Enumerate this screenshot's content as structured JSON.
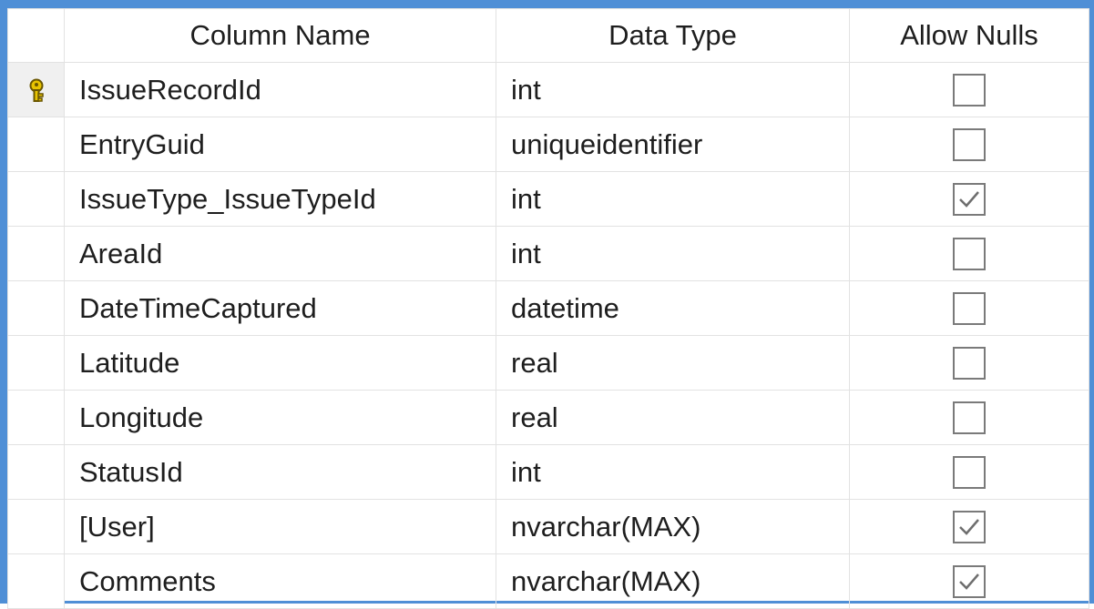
{
  "headers": {
    "column_name": "Column Name",
    "data_type": "Data Type",
    "allow_nulls": "Allow Nulls"
  },
  "rows": [
    {
      "name": "IssueRecordId",
      "type": "int",
      "allow_nulls": false,
      "primary_key": true
    },
    {
      "name": "EntryGuid",
      "type": "uniqueidentifier",
      "allow_nulls": false
    },
    {
      "name": "IssueType_IssueTypeId",
      "type": "int",
      "allow_nulls": true
    },
    {
      "name": "AreaId",
      "type": "int",
      "allow_nulls": false
    },
    {
      "name": "DateTimeCaptured",
      "type": "datetime",
      "allow_nulls": false
    },
    {
      "name": "Latitude",
      "type": "real",
      "allow_nulls": false
    },
    {
      "name": "Longitude",
      "type": "real",
      "allow_nulls": false
    },
    {
      "name": "StatusId",
      "type": "int",
      "allow_nulls": false
    },
    {
      "name": "[User]",
      "type": "nvarchar(MAX)",
      "allow_nulls": true
    },
    {
      "name": "Comments",
      "type": "nvarchar(MAX)",
      "allow_nulls": true
    }
  ],
  "icons": {
    "primary_key": "key-icon",
    "checked": "checkmark-icon"
  },
  "colors": {
    "window_border": "#4f8fd6",
    "key": "#d4b000"
  }
}
